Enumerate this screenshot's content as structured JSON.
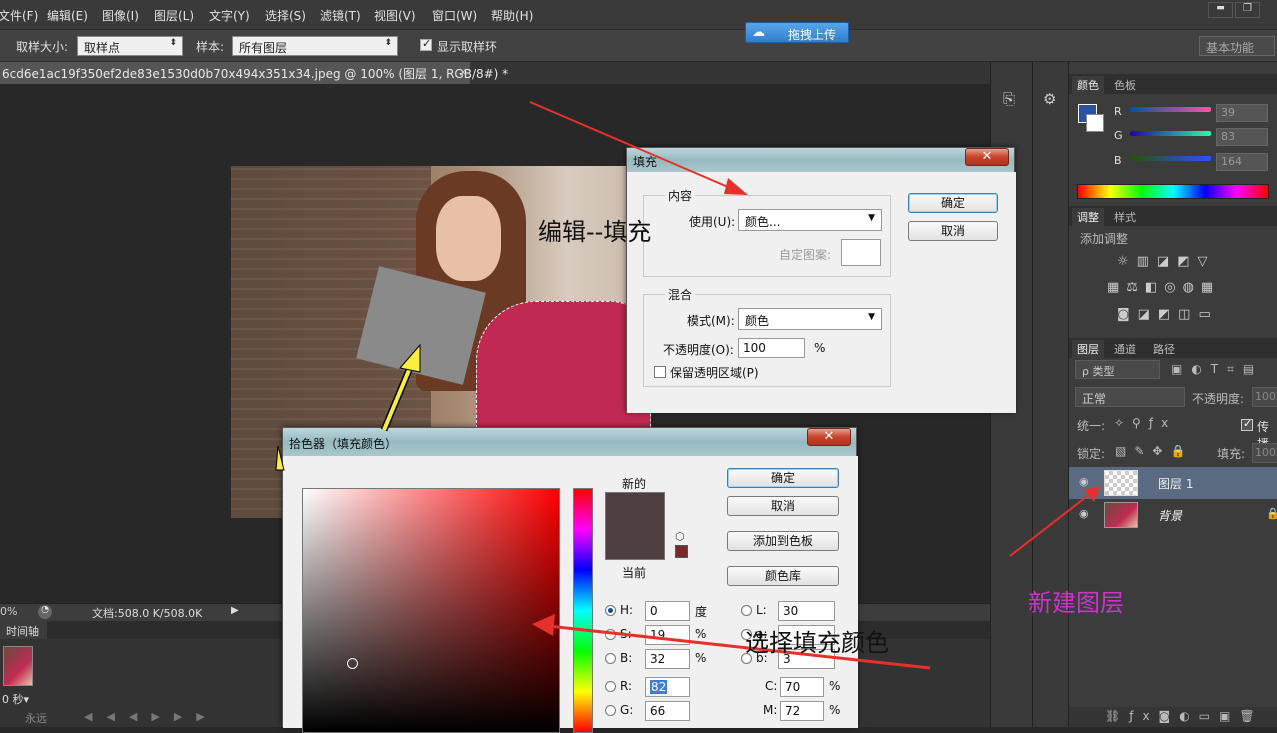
{
  "menu": [
    "文件(F)",
    "编辑(E)",
    "图像(I)",
    "图层(L)",
    "文字(Y)",
    "选择(S)",
    "滤镜(T)",
    "视图(V)",
    "窗口(W)",
    "帮助(H)"
  ],
  "upload_button": "拖拽上传",
  "window_controls": {
    "minimize": "▬",
    "restore": "❐"
  },
  "options": {
    "sample_size_label": "取样大小:",
    "sample_size_value": "取样点",
    "sample_label": "样本:",
    "sample_value": "所有图层",
    "show_ring_label": "显示取样环",
    "workspace": "基本功能"
  },
  "document_tab": "6cd6e1ac19f350ef2de83e1530d0b70x494x351x34.jpeg @ 100% (图层 1, RGB/8#) *",
  "document_tab_close": "×",
  "status": {
    "zoom": "0%",
    "doc": "文档:508.0 K/508.0K"
  },
  "timeline": {
    "tab": "时间轴",
    "frame_time": "0 秒▾",
    "loop": "永远"
  },
  "color_panel": {
    "tabs": [
      "颜色",
      "色板"
    ],
    "channels": [
      {
        "label": "R",
        "value": "39",
        "color": "#2c4fa4"
      },
      {
        "label": "G",
        "value": "83"
      },
      {
        "label": "B",
        "value": "164"
      }
    ],
    "fg_color": "#2753a4"
  },
  "adjust_panel": {
    "tabs": [
      "调整",
      "样式"
    ],
    "title": "添加调整"
  },
  "layers_panel": {
    "tabs": [
      "图层",
      "通道",
      "路径"
    ],
    "filter": "ρ 类型",
    "blend_mode": "正常",
    "opacity_label": "不透明度:",
    "opacity_value": "100",
    "unify_label": "统一:",
    "propagate_label": "传播",
    "lock_label": "锁定:",
    "fill_label": "填充:",
    "fill_value": "100",
    "layers": [
      {
        "name": "图层 1",
        "selected": true
      },
      {
        "name": "背景",
        "selected": false
      }
    ]
  },
  "fill_dialog": {
    "title": "填充",
    "content_group": "内容",
    "use_label": "使用(U):",
    "use_value": "颜色...",
    "custom_pattern_label": "自定图案:",
    "blend_group": "混合",
    "mode_label": "模式(M):",
    "mode_value": "颜色",
    "opacity_label": "不透明度(O):",
    "opacity_value": "100",
    "opacity_unit": "%",
    "preserve_label": "保留透明区域(P)",
    "ok": "确定",
    "cancel": "取消",
    "close": "✕"
  },
  "picker_dialog": {
    "title": "拾色器（填充颜色）",
    "new_label": "新的",
    "current_label": "当前",
    "ok": "确定",
    "cancel": "取消",
    "add_swatch": "添加到色板",
    "color_lib": "颜色库",
    "close": "✕",
    "new_color": "#4f3f40",
    "current_color": "#7a2a2a",
    "fields": {
      "H": "0",
      "H_unit": "度",
      "S": "19",
      "S_unit": "%",
      "B": "32",
      "B_unit": "%",
      "R": "82",
      "G": "66",
      "L": "30",
      "a": "",
      "b": "3",
      "C": "70",
      "M": "72",
      "pct": "%"
    }
  },
  "annotations": {
    "edit_fill": "编辑--填充",
    "choose_color": "选择填充颜色",
    "new_layer": "新建图层"
  }
}
